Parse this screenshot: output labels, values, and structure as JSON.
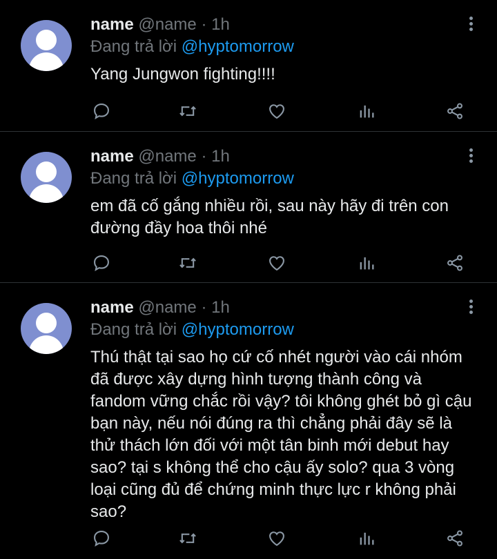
{
  "tweets": [
    {
      "name": "name",
      "handle": "@name",
      "separator": "·",
      "time": "1h",
      "reply_prefix": "Đang trả lời",
      "reply_to": "@hyptomorrow",
      "text": "Yang Jungwon fighting!!!!"
    },
    {
      "name": "name",
      "handle": "@name",
      "separator": "·",
      "time": "1h",
      "reply_prefix": "Đang trả lời",
      "reply_to": "@hyptomorrow",
      "text": "em đã cố gắng nhiều rồi, sau này hãy đi trên con đường đầy hoa thôi nhé"
    },
    {
      "name": "name",
      "handle": "@name",
      "separator": "·",
      "time": "1h",
      "reply_prefix": "Đang trả lời",
      "reply_to": "@hyptomorrow",
      "text": "Thú thật tại sao họ cứ cố nhét người vào cái nhóm đã được xây dựng hình tượng thành công và fandom vững chắc rồi vậy? tôi không ghét bỏ gì cậu bạn này, nếu nói đúng ra thì chẳng phải đây sẽ là thử thách lớn đối với một tân binh mới debut hay sao? tại s không thể cho cậu ấy solo? qua 3 vòng loại cũng đủ để chứng minh thực lực r không phải sao?"
    }
  ],
  "icons": [
    "more-icon",
    "reply-icon",
    "retweet-icon",
    "like-icon",
    "stats-icon",
    "share-icon",
    "avatar-placeholder-icon"
  ],
  "colors": {
    "background": "#000000",
    "text": "#e7e9ea",
    "muted": "#71767b",
    "mention": "#1d9bf0",
    "divider": "#2f3336",
    "avatar": "#7f8fd0",
    "icon": "#8b98a5"
  }
}
